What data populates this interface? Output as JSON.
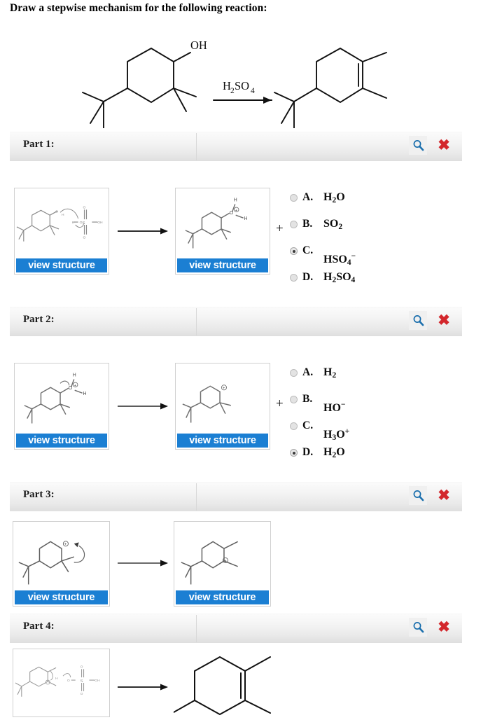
{
  "prompt": {
    "title": "Draw a stepwise mechanism for the following reaction:"
  },
  "reaction_scheme": {
    "reagent_label": "H2SO4",
    "reagent_html_parts": {
      "h": "H",
      "sub2": "2",
      "so": "SO",
      "sub4": "4"
    },
    "reactant_label": "OH",
    "arrow": "reaction-arrow"
  },
  "icons": {
    "zoom": "magnifier-icon",
    "close": "close-x-icon",
    "close_glyph": "✖",
    "plus_glyph": "+"
  },
  "colors": {
    "button_blue": "#1b7fd3",
    "close_red": "#d3272c",
    "zoom_blue": "#1b6fad",
    "bar_gray": "#eaeaea"
  },
  "view_structure_label": "view structure",
  "parts": [
    {
      "label": "Part 1:",
      "left_structure": "protonation-of-alcohol-by-sulfuric-acid",
      "right_structure": "protonated-alcohol-oxonium-ion",
      "has_plus": true,
      "options": [
        {
          "letter": "A.",
          "formula": "H2O",
          "selected": false
        },
        {
          "letter": "B.",
          "formula": "SO2",
          "selected": false
        },
        {
          "letter": "C.",
          "formula": "HSO4-",
          "selected": true
        },
        {
          "letter": "D.",
          "formula": "H2SO4",
          "selected": false
        }
      ]
    },
    {
      "label": "Part 2:",
      "left_structure": "oxonium-ion-losing-water",
      "right_structure": "tertiary-carbocation",
      "has_plus": true,
      "options": [
        {
          "letter": "A.",
          "formula": "H2",
          "selected": false
        },
        {
          "letter": "B.",
          "formula": "HO-",
          "selected": false
        },
        {
          "letter": "C.",
          "formula": "H3O+",
          "selected": false
        },
        {
          "letter": "D.",
          "formula": "H2O",
          "selected": true
        }
      ]
    },
    {
      "label": "Part 3:",
      "left_structure": "carbocation-hydride-shift",
      "right_structure": "rearranged-carbocation",
      "has_plus": false,
      "options": []
    },
    {
      "label": "Part 4:",
      "left_structure": "deprotonation-by-bisulfate",
      "right_structure": "alkene-product",
      "has_plus": false,
      "options": []
    }
  ]
}
